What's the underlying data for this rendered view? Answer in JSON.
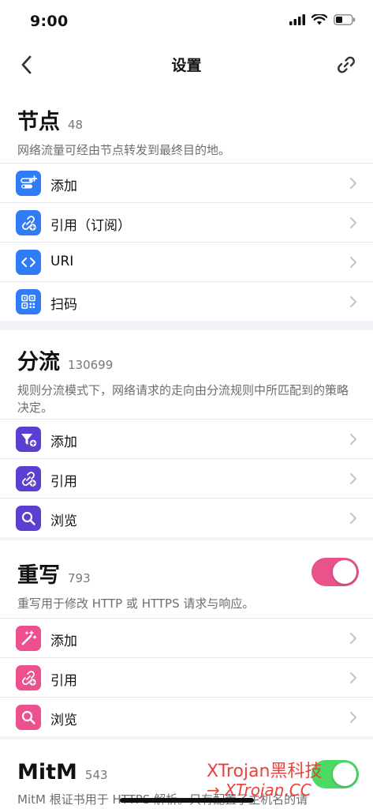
{
  "status": {
    "time": "9:00"
  },
  "nav": {
    "title": "设置"
  },
  "nodes": {
    "title": "节点",
    "count": "48",
    "desc": "网络流量可经由节点转发到最终目的地。",
    "rows": [
      {
        "label": "添加",
        "icon": "toggle-add-icon"
      },
      {
        "label": "引用（订阅）",
        "icon": "link-add-icon"
      },
      {
        "label": "URI",
        "icon": "code-icon"
      },
      {
        "label": "扫码",
        "icon": "qrcode-icon"
      }
    ]
  },
  "rules": {
    "title": "分流",
    "count": "130699",
    "desc": "规则分流模式下，网络请求的走向由分流规则中所匹配到的策略决定。",
    "rows": [
      {
        "label": "添加",
        "icon": "filter-add-icon"
      },
      {
        "label": "引用",
        "icon": "link-add-icon"
      },
      {
        "label": "浏览",
        "icon": "search-icon"
      }
    ]
  },
  "rewrite": {
    "title": "重写",
    "count": "793",
    "desc": "重写用于修改 HTTP 或 HTTPS 请求与响应。",
    "enabled": true,
    "rows": [
      {
        "label": "添加",
        "icon": "magic-wand-icon"
      },
      {
        "label": "引用",
        "icon": "link-add-icon"
      },
      {
        "label": "浏览",
        "icon": "search-icon"
      }
    ]
  },
  "mitm": {
    "title": "MitM",
    "count": "543",
    "desc": "MitM 根证书用于 HTTPS 解析。只有配置了主机名的请"
  },
  "watermark": {
    "line1": "XTrojan黑科技",
    "line2": "→ XTrojan.CC"
  },
  "colors": {
    "blue": "#2f7cf6",
    "purple": "#5b3fd0",
    "pink": "#ee4f8f",
    "toggle_on": "#e8538c"
  }
}
